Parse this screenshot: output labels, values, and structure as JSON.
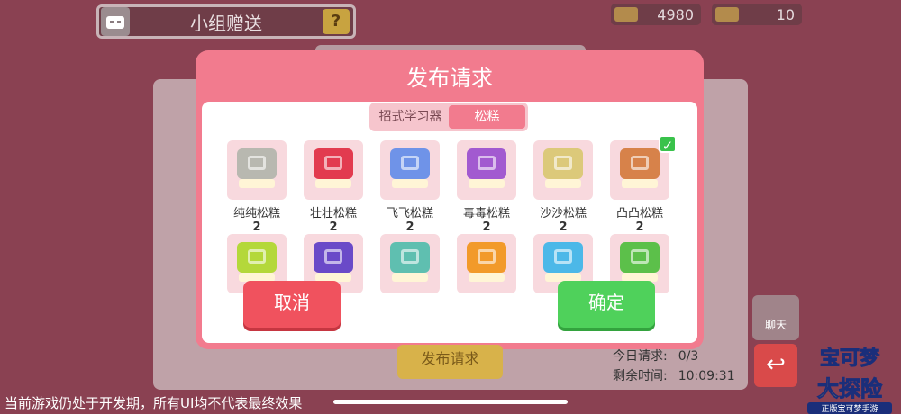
{
  "header": {
    "title": "小组赠送",
    "help": "?",
    "coins": "4980",
    "tickets": "10"
  },
  "dialog": {
    "title": "发布请求",
    "tabs": [
      {
        "label": "招式学习器",
        "active": false
      },
      {
        "label": "松糕",
        "active": true
      }
    ],
    "items": [
      {
        "name": "纯纯松糕",
        "count": "2",
        "color": "#b8b8b0",
        "selected": false
      },
      {
        "name": "壮壮松糕",
        "count": "2",
        "color": "#e23b4f",
        "selected": false
      },
      {
        "name": "飞飞松糕",
        "count": "2",
        "color": "#6f93e8",
        "selected": false
      },
      {
        "name": "毒毒松糕",
        "count": "2",
        "color": "#a25ad0",
        "selected": false
      },
      {
        "name": "沙沙松糕",
        "count": "2",
        "color": "#dcc97a",
        "selected": false
      },
      {
        "name": "凸凸松糕",
        "count": "2",
        "color": "#d7824a",
        "selected": true
      },
      {
        "name": "",
        "count": "",
        "color": "#b4d83a",
        "selected": false
      },
      {
        "name": "",
        "count": "",
        "color": "#6a4ac8",
        "selected": false
      },
      {
        "name": "",
        "count": "",
        "color": "#5fbfb0",
        "selected": false
      },
      {
        "name": "",
        "count": "",
        "color": "#f29a2a",
        "selected": false
      },
      {
        "name": "",
        "count": "",
        "color": "#4cb8e8",
        "selected": false
      },
      {
        "name": "",
        "count": "",
        "color": "#5cc04a",
        "selected": false
      }
    ],
    "cancel_label": "取消",
    "confirm_label": "确定"
  },
  "footer": {
    "publish_label": "发布请求",
    "today_label": "今日请求:",
    "today_value": "0/3",
    "remaining_label": "剩余时间:",
    "remaining_value": "10:09:31",
    "chat_label": "聊天",
    "logo_line1": "宝可梦",
    "logo_line2": "大探险",
    "logo_line3": "正版宝可梦手游",
    "disclaimer": "当前游戏仍处于开发期，所有UI均不代表最终效果"
  }
}
